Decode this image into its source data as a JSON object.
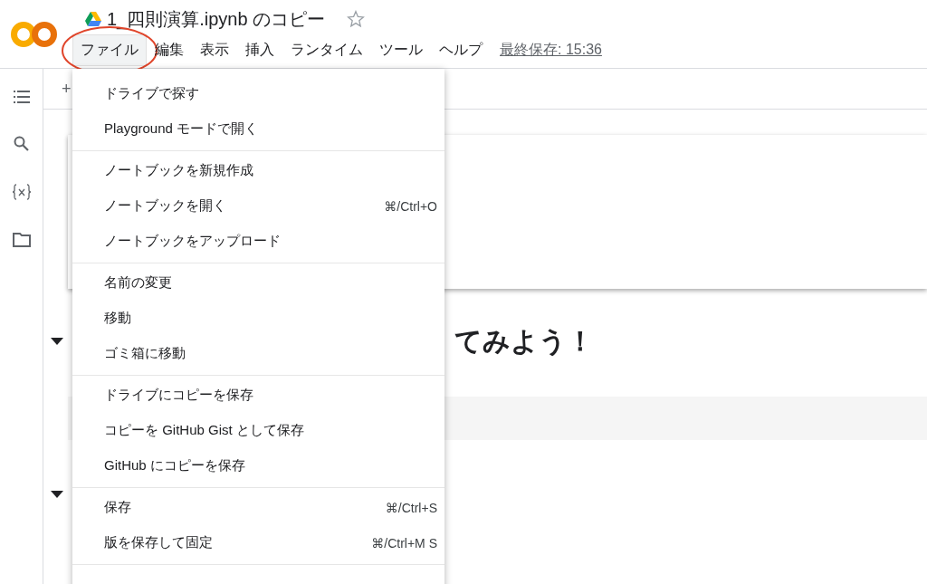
{
  "header": {
    "title": "1_四則演算.ipynb のコピー",
    "starred": false
  },
  "menubar": [
    {
      "label": "ファイル",
      "selected": true
    },
    {
      "label": "編集",
      "selected": false
    },
    {
      "label": "表示",
      "selected": false
    },
    {
      "label": "挿入",
      "selected": false
    },
    {
      "label": "ランタイム",
      "selected": false
    },
    {
      "label": "ツール",
      "selected": false
    },
    {
      "label": "ヘルプ",
      "selected": false
    }
  ],
  "last_saved": "最終保存: 15:36",
  "toolbar": {
    "add_label": "+"
  },
  "notebook": {
    "heading": "てみよう！"
  },
  "file_menu": {
    "sections": [
      [
        {
          "label": "ドライブで探す"
        },
        {
          "label": "Playground モードで開く"
        }
      ],
      [
        {
          "label": "ノートブックを新規作成"
        },
        {
          "label": "ノートブックを開く",
          "shortcut": "⌘/Ctrl+O"
        },
        {
          "label": "ノートブックをアップロード"
        }
      ],
      [
        {
          "label": "名前の変更"
        },
        {
          "label": "移動"
        },
        {
          "label": "ゴミ箱に移動"
        }
      ],
      [
        {
          "label": "ドライブにコピーを保存"
        },
        {
          "label": "コピーを GitHub Gist として保存"
        },
        {
          "label": "GitHub にコピーを保存"
        }
      ],
      [
        {
          "label": "保存",
          "shortcut": "⌘/Ctrl+S"
        },
        {
          "label": "版を保存して固定",
          "shortcut": "⌘/Ctrl+M S"
        }
      ]
    ]
  }
}
